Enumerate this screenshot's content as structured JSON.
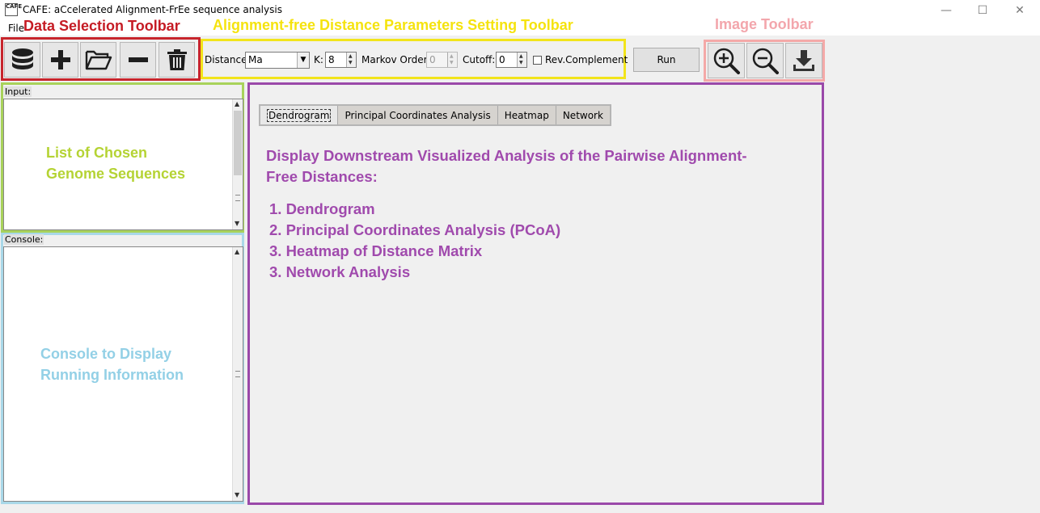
{
  "window": {
    "title": "CAFE: aCcelerated Alignment-FrEe sequence analysis",
    "icon_text": "CAFE",
    "controls": {
      "minimize": "—",
      "maximize": "☐",
      "close": "✕"
    }
  },
  "menu": {
    "file": "File"
  },
  "annotations": {
    "data_toolbar": "Data Selection Toolbar",
    "param_toolbar": "Alignment-free Distance Parameters Setting Toolbar",
    "image_toolbar": "Image Toolbar",
    "input_list": [
      "List of Chosen",
      "Genome Sequences"
    ],
    "console": [
      "Console to Display",
      "Running Information"
    ]
  },
  "colors": {
    "data_frame": "#c7252c",
    "param_frame": "#f2e41b",
    "image_frame": "#f4a9a8",
    "input_frame": "#a8d25b",
    "console_frame": "#a9d8e8",
    "main_frame": "#9a49a9",
    "main_text": "#a04aad",
    "input_text": "#b5d334",
    "console_text": "#93d0e6"
  },
  "data_toolbar": {
    "icons": [
      "database-icon",
      "plus-icon",
      "folder-open-icon",
      "minus-icon",
      "trash-icon"
    ]
  },
  "params": {
    "distance_label": "Distance:",
    "distance_value": "Ma",
    "k_label": "K:",
    "k_value": "8",
    "markov_label": "Markov Order:",
    "markov_value": "0",
    "cutoff_label": "Cutoff:",
    "cutoff_value": "0",
    "rev_complement_label": "Rev.Complement",
    "rev_complement_checked": false,
    "run_label": "Run"
  },
  "image_toolbar": {
    "icons": [
      "zoom-in-icon",
      "zoom-out-icon",
      "download-icon"
    ]
  },
  "left": {
    "input_label": "Input:",
    "console_label": "Console:"
  },
  "main": {
    "tabs": [
      "Dendrogram",
      "Principal Coordinates Analysis",
      "Heatmap",
      "Network"
    ],
    "active_tab": "Dendrogram",
    "heading_line1": "Display Downstream Visualized Analysis of the Pairwise Alignment-",
    "heading_line2": "Free Distances:",
    "items": [
      "1. Dendrogram",
      "2. Principal Coordinates Analysis (PCoA)",
      "3. Heatmap of Distance Matrix",
      "3. Network Analysis"
    ]
  }
}
